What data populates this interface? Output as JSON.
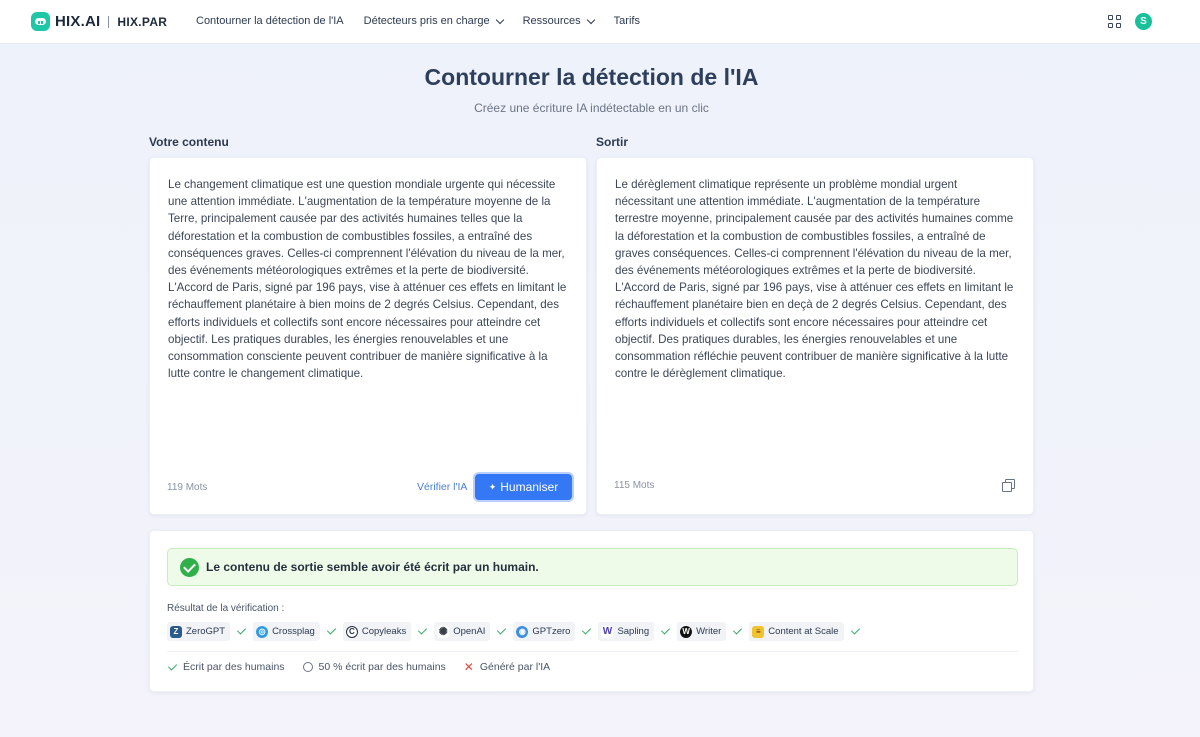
{
  "header": {
    "logo_text": "HIX.AI",
    "logo_sub": "HIX.PAR",
    "nav": [
      {
        "label": "Contourner la détection de l'IA"
      },
      {
        "label": "Détecteurs pris en charge"
      },
      {
        "label": "Ressources"
      },
      {
        "label": "Tarifs"
      }
    ],
    "avatar_initial": "S"
  },
  "page": {
    "title": "Contourner la détection de l'IA",
    "subtitle": "Créez une écriture IA indétectable en un clic"
  },
  "input": {
    "label": "Votre contenu",
    "text": "Le changement climatique est une question mondiale urgente qui nécessite une attention immédiate. L'augmentation de la température moyenne de la Terre, principalement causée par des activités humaines telles que la déforestation et la combustion de combustibles fossiles, a entraîné des conséquences graves. Celles-ci comprennent l'élévation du niveau de la mer, des événements météorologiques extrêmes et la perte de biodiversité. L'Accord de Paris, signé par 196 pays, vise à atténuer ces effets en limitant le réchauffement planétaire à bien moins de 2 degrés Celsius. Cependant, des efforts individuels et collectifs sont encore nécessaires pour atteindre cet objectif. Les pratiques durables, les énergies renouvelables et une consommation consciente peuvent contribuer de manière significative à la lutte contre le changement climatique.",
    "word_count": "119 Mots",
    "verify_label": "Vérifier l'IA",
    "humanize_label": "Humaniser"
  },
  "output": {
    "label": "Sortir",
    "text": "Le dérèglement climatique représente un problème mondial urgent nécessitant une attention immédiate. L'augmentation de la température terrestre moyenne, principalement causée par des activités humaines comme la déforestation et la combustion de combustibles fossiles, a entraîné de graves conséquences. Celles-ci comprennent l'élévation du niveau de la mer, des événements météorologiques extrêmes et la perte de biodiversité. L'Accord de Paris, signé par 196 pays, vise à atténuer ces effets en limitant le réchauffement planétaire bien en deçà de 2 degrés Celsius. Cependant, des efforts individuels et collectifs sont encore nécessaires pour atteindre cet objectif. Des pratiques durables, les énergies renouvelables et une consommation réfléchie peuvent contribuer de manière significative à la lutte contre le dérèglement climatique.",
    "word_count": "115 Mots"
  },
  "result": {
    "banner": "Le contenu de sortie semble avoir été écrit par un humain.",
    "verification_label": "Résultat de la vérification :",
    "detectors": [
      {
        "name": "ZeroGPT",
        "icon": "zerogpt-icon",
        "color": "#2b5a8c"
      },
      {
        "name": "Crossplag",
        "icon": "crossplag-icon",
        "color": "#2f9be3"
      },
      {
        "name": "Copyleaks",
        "icon": "copyleaks-icon",
        "color": "#1f2b3d"
      },
      {
        "name": "OpenAI",
        "icon": "openai-icon",
        "color": "#3a3f47"
      },
      {
        "name": "GPTzero",
        "icon": "gptzero-icon",
        "color": "#3a8fe0"
      },
      {
        "name": "Sapling",
        "icon": "sapling-icon",
        "color": "#4a3fb0"
      },
      {
        "name": "Writer",
        "icon": "writer-icon",
        "color": "#111111"
      },
      {
        "name": "Content at Scale",
        "icon": "content-at-scale-icon",
        "color": "#f2c230"
      }
    ],
    "legend": {
      "human": "Écrit par des humains",
      "half": "50 % écrit par des humains",
      "ai": "Généré par l'IA"
    }
  },
  "colors": {
    "accent": "#3478f6",
    "brand": "#1ec7a8",
    "success": "#2fb04a",
    "error": "#e0453b"
  }
}
